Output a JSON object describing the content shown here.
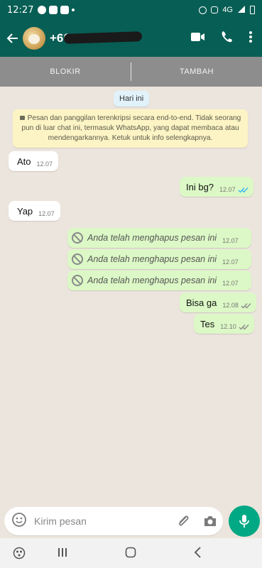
{
  "status_bar": {
    "time": "12:27",
    "network": "4G"
  },
  "header": {
    "contact_name": "+60 13"
  },
  "action_bar": {
    "block_label": "BLOKIR",
    "add_label": "TAMBAH"
  },
  "chat": {
    "date_chip": "Hari ini",
    "encryption_notice": "Pesan dan panggilan terenkripsi secara end-to-end. Tidak seorang pun di luar chat ini, termasuk WhatsApp, yang dapat membaca atau mendengarkannya. Ketuk untuk info selengkapnya.",
    "messages": [
      {
        "text": "Ato",
        "time": "12.07",
        "direction": "in"
      },
      {
        "text": "Ini bg?",
        "time": "12.07",
        "direction": "out",
        "status": "read"
      },
      {
        "text": "Yap",
        "time": "12.07",
        "direction": "in"
      },
      {
        "text": "Anda telah menghapus pesan ini",
        "time": "12.07",
        "direction": "out",
        "deleted": true
      },
      {
        "text": "Anda telah menghapus pesan ini",
        "time": "12.07",
        "direction": "out",
        "deleted": true
      },
      {
        "text": "Anda telah menghapus pesan ini",
        "time": "12.07",
        "direction": "out",
        "deleted": true
      },
      {
        "text": "Bisa ga",
        "time": "12.08",
        "direction": "out",
        "status": "delivered"
      },
      {
        "text": "Tes",
        "time": "12.10",
        "direction": "out",
        "status": "delivered"
      }
    ]
  },
  "composer": {
    "placeholder": "Kirim pesan"
  },
  "colors": {
    "header": "#075e54",
    "outgoing_bubble": "#dcf8c6",
    "read_ticks": "#34b7f1",
    "mic_button": "#00a884"
  },
  "icons": [
    "back-arrow-icon",
    "video-call-icon",
    "voice-call-icon",
    "more-options-icon",
    "lock-icon",
    "deleted-message-icon",
    "emoji-icon",
    "attach-icon",
    "camera-icon",
    "mic-icon"
  ]
}
